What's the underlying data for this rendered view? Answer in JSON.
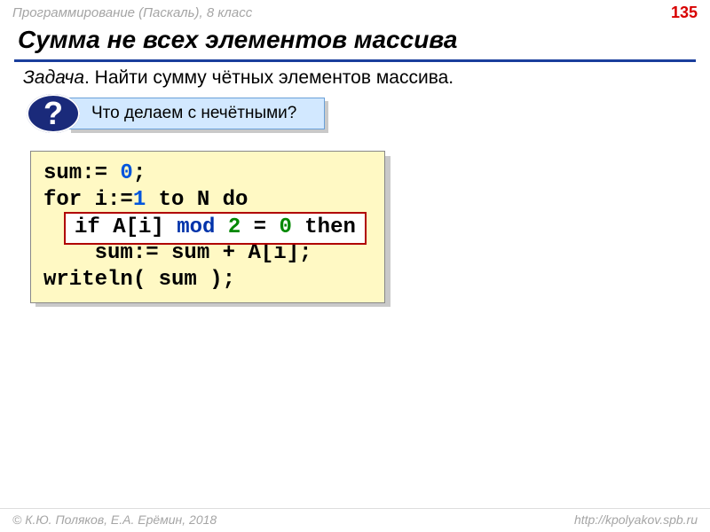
{
  "topbar": {
    "course": "Программирование (Паскаль), 8 класс",
    "page": "135"
  },
  "heading": "Сумма не всех элементов массива",
  "task": {
    "label": "Задача",
    "text": ". Найти сумму чётных элементов массива."
  },
  "callout": {
    "badge": "?",
    "text": "Что делаем с нечётными?"
  },
  "code": {
    "l1a": "sum:= ",
    "l1n": "0",
    "l1b": ";",
    "l2a": "for i:=",
    "l2n": "1",
    "l2b": " to N do",
    "l3": "",
    "l4": "    sum:= sum + A[i];",
    "l5": "writeln( sum );"
  },
  "overlay": {
    "a": "if A[i] ",
    "kw": "mod",
    "sp1": " ",
    "n": "2",
    "b": " = ",
    "z": "0",
    "c": " then"
  },
  "footer": {
    "left": "© К.Ю. Поляков, Е.А. Ерёмин, 2018",
    "right": "http://kpolyakov.spb.ru"
  }
}
